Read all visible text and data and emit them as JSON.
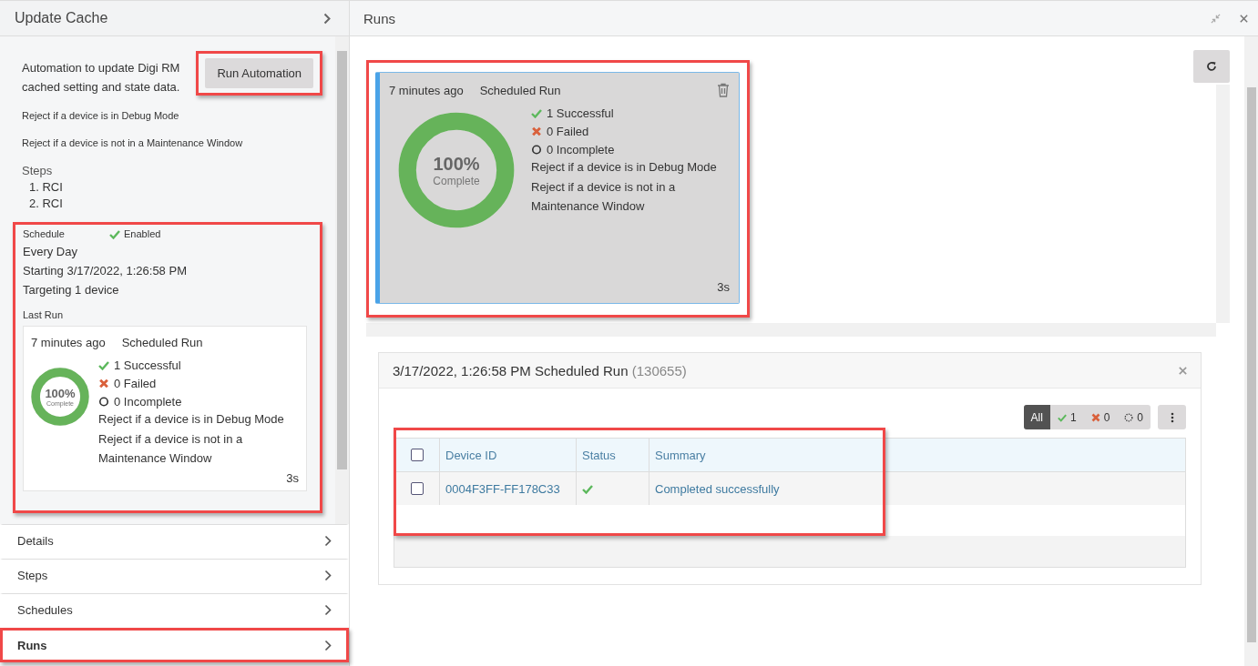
{
  "left_panel": {
    "title": "Update Cache",
    "description": "Automation to update Digi RM cached setting and state data.",
    "run_button": {
      "label": "Run Automation",
      "highlighted": true
    },
    "rules": [
      "Reject if a device is in Debug Mode",
      "Reject if a device is not in a Maintenance Window"
    ],
    "steps_heading": "Steps",
    "steps": [
      {
        "number": "1.",
        "label": "RCI"
      },
      {
        "number": "2.",
        "label": "RCI"
      }
    ],
    "schedule": {
      "highlighted": true,
      "label": "Schedule",
      "status": "Enabled",
      "enabled": true,
      "lines": [
        "Every Day",
        "Starting 3/17/2022, 1:26:58 PM",
        "Targeting 1 device"
      ],
      "last_run_label": "Last Run",
      "last_run": {
        "time": "7 minutes ago",
        "type": "Scheduled Run",
        "level": 1,
        "percent": "100%",
        "percent_label": "Complete",
        "counts": [
          {
            "kind": "success",
            "label": "1 Successful"
          },
          {
            "kind": "failed",
            "label": "0 Failed"
          },
          {
            "kind": "incomplete",
            "label": "0 Incomplete"
          }
        ],
        "notes": [
          "Reject if a device is in Debug Mode",
          "Reject if a device is not in a Maintenance Window"
        ],
        "duration": "3s"
      }
    },
    "sections": [
      {
        "label": "Details",
        "highlighted": false
      },
      {
        "label": "Steps",
        "highlighted": false
      },
      {
        "label": "Schedules",
        "highlighted": false
      },
      {
        "label": "Runs",
        "highlighted": true
      }
    ]
  },
  "runs_panel": {
    "title": "Runs",
    "runs": [
      {
        "selected": true,
        "highlighted": true,
        "time": "7 minutes ago",
        "type": "Scheduled Run",
        "level": 1,
        "percent": "100%",
        "percent_label": "Complete",
        "counts": [
          {
            "kind": "success",
            "label": "1 Successful"
          },
          {
            "kind": "failed",
            "label": "0 Failed"
          },
          {
            "kind": "incomplete",
            "label": "0 Incomplete"
          }
        ],
        "notes": [
          "Reject if a device is in Debug Mode",
          "Reject if a device is not in a Maintenance Window"
        ],
        "duration": "3s"
      }
    ],
    "detail": {
      "title": "3/17/2022, 1:26:58 PM Scheduled Run",
      "id": "(130655)",
      "filters": [
        {
          "kind": "all",
          "label": "All",
          "selected": true
        },
        {
          "kind": "success",
          "label": "1",
          "selected": false
        },
        {
          "kind": "failed",
          "label": "0",
          "selected": false
        },
        {
          "kind": "incomplete",
          "label": "0",
          "selected": false
        }
      ],
      "table": {
        "highlighted": true,
        "header_checked": false,
        "columns": [
          "Device ID",
          "Status",
          "Summary"
        ],
        "rows": [
          {
            "checked": false,
            "device_id": "0004F3FF-FF178C33",
            "kind": "success",
            "summary": "Completed successfully"
          }
        ]
      }
    }
  }
}
